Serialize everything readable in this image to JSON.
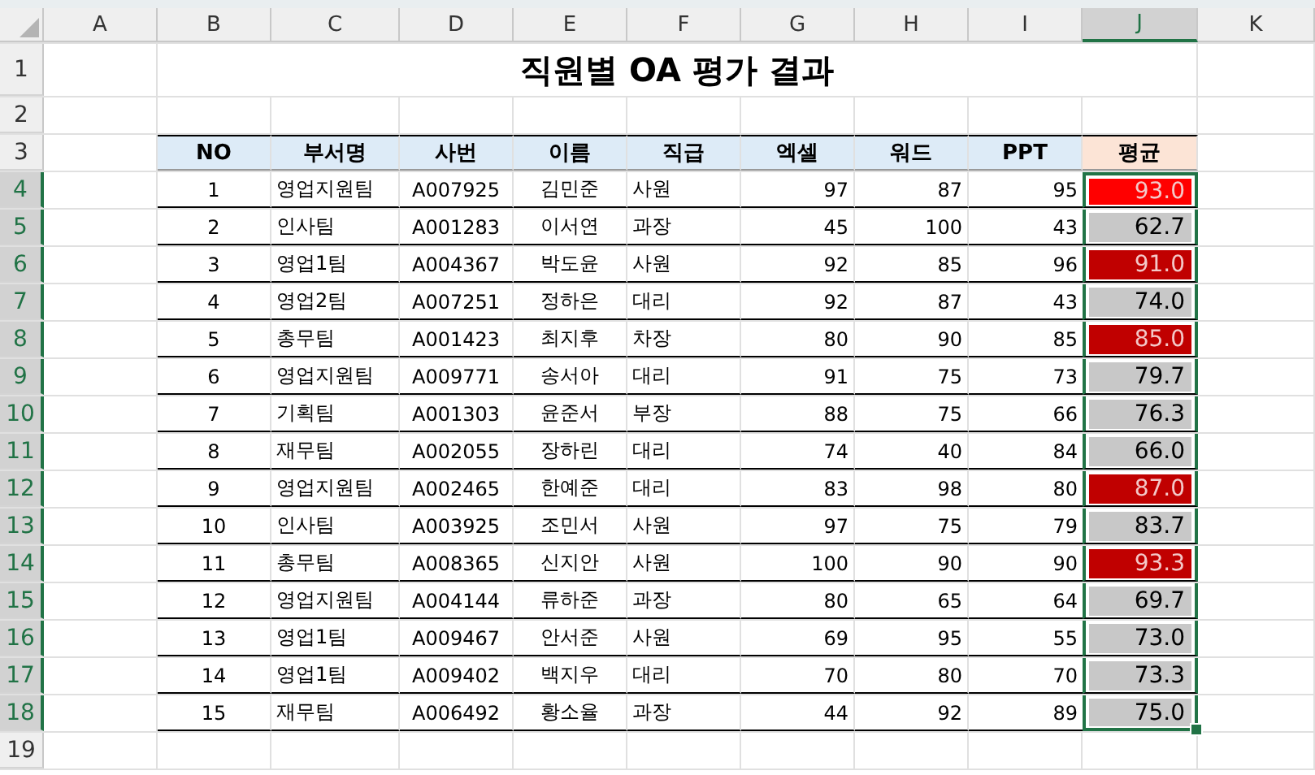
{
  "column_headers": [
    {
      "label": "A",
      "selected": false
    },
    {
      "label": "B",
      "selected": false
    },
    {
      "label": "C",
      "selected": false
    },
    {
      "label": "D",
      "selected": false
    },
    {
      "label": "E",
      "selected": false
    },
    {
      "label": "F",
      "selected": false
    },
    {
      "label": "G",
      "selected": false
    },
    {
      "label": "H",
      "selected": false
    },
    {
      "label": "I",
      "selected": false
    },
    {
      "label": "J",
      "selected": true
    },
    {
      "label": "K",
      "selected": false
    }
  ],
  "row_headers": [
    {
      "label": "1",
      "selected": false
    },
    {
      "label": "2",
      "selected": false
    },
    {
      "label": "3",
      "selected": false
    },
    {
      "label": "4",
      "selected": true
    },
    {
      "label": "5",
      "selected": true
    },
    {
      "label": "6",
      "selected": true
    },
    {
      "label": "7",
      "selected": true
    },
    {
      "label": "8",
      "selected": true
    },
    {
      "label": "9",
      "selected": true
    },
    {
      "label": "10",
      "selected": true
    },
    {
      "label": "11",
      "selected": true
    },
    {
      "label": "12",
      "selected": true
    },
    {
      "label": "13",
      "selected": true
    },
    {
      "label": "14",
      "selected": true
    },
    {
      "label": "15",
      "selected": true
    },
    {
      "label": "16",
      "selected": true
    },
    {
      "label": "17",
      "selected": true
    },
    {
      "label": "18",
      "selected": true
    },
    {
      "label": "19",
      "selected": false
    }
  ],
  "title": "직원별 OA 평가 결과",
  "table": {
    "columns": [
      "NO",
      "부서명",
      "사번",
      "이름",
      "직급",
      "엑셀",
      "워드",
      "PPT",
      "평균"
    ],
    "rows": [
      {
        "cells": [
          "1",
          "영업지원팀",
          "A007925",
          "김민준",
          "사원",
          "97",
          "87",
          "95"
        ],
        "average": "93.0",
        "color": "#ff0000"
      },
      {
        "cells": [
          "2",
          "인사팀",
          "A001283",
          "이서연",
          "과장",
          "45",
          "100",
          "43"
        ],
        "average": "62.7",
        "color": "#c8c8c8"
      },
      {
        "cells": [
          "3",
          "영업1팀",
          "A004367",
          "박도윤",
          "사원",
          "92",
          "85",
          "96"
        ],
        "average": "91.0",
        "color": "#c00000"
      },
      {
        "cells": [
          "4",
          "영업2팀",
          "A007251",
          "정하은",
          "대리",
          "92",
          "87",
          "43"
        ],
        "average": "74.0",
        "color": "#c8c8c8"
      },
      {
        "cells": [
          "5",
          "총무팀",
          "A001423",
          "최지후",
          "차장",
          "80",
          "90",
          "85"
        ],
        "average": "85.0",
        "color": "#c00000"
      },
      {
        "cells": [
          "6",
          "영업지원팀",
          "A009771",
          "송서아",
          "대리",
          "91",
          "75",
          "73"
        ],
        "average": "79.7",
        "color": "#c8c8c8"
      },
      {
        "cells": [
          "7",
          "기획팀",
          "A001303",
          "윤준서",
          "부장",
          "88",
          "75",
          "66"
        ],
        "average": "76.3",
        "color": "#c8c8c8"
      },
      {
        "cells": [
          "8",
          "재무팀",
          "A002055",
          "장하린",
          "대리",
          "74",
          "40",
          "84"
        ],
        "average": "66.0",
        "color": "#c8c8c8"
      },
      {
        "cells": [
          "9",
          "영업지원팀",
          "A002465",
          "한예준",
          "대리",
          "83",
          "98",
          "80"
        ],
        "average": "87.0",
        "color": "#c00000"
      },
      {
        "cells": [
          "10",
          "인사팀",
          "A003925",
          "조민서",
          "사원",
          "97",
          "75",
          "79"
        ],
        "average": "83.7",
        "color": "#c8c8c8"
      },
      {
        "cells": [
          "11",
          "총무팀",
          "A008365",
          "신지안",
          "사원",
          "100",
          "90",
          "90"
        ],
        "average": "93.3",
        "color": "#c00000"
      },
      {
        "cells": [
          "12",
          "영업지원팀",
          "A004144",
          "류하준",
          "과장",
          "80",
          "65",
          "64"
        ],
        "average": "69.7",
        "color": "#c8c8c8"
      },
      {
        "cells": [
          "13",
          "영업1팀",
          "A009467",
          "안서준",
          "사원",
          "69",
          "95",
          "55"
        ],
        "average": "73.0",
        "color": "#c8c8c8"
      },
      {
        "cells": [
          "14",
          "영업1팀",
          "A009402",
          "백지우",
          "대리",
          "70",
          "80",
          "70"
        ],
        "average": "73.3",
        "color": "#c8c8c8"
      },
      {
        "cells": [
          "15",
          "재무팀",
          "A006492",
          "황소율",
          "과장",
          "44",
          "92",
          "89"
        ],
        "average": "75.0",
        "color": "#c8c8c8"
      }
    ]
  }
}
